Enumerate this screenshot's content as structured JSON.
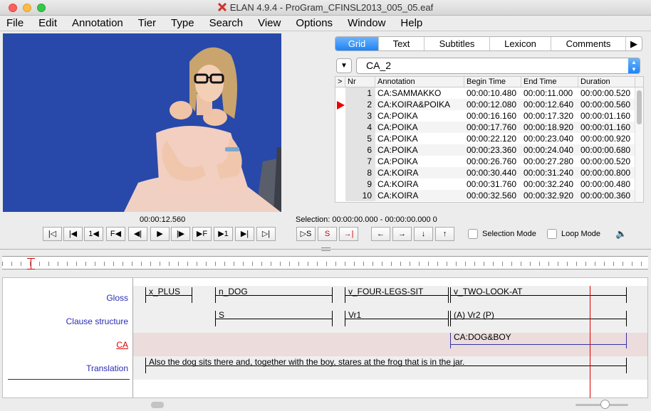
{
  "window": {
    "title": "ELAN 4.9.4 - ProGram_CFINSL2013_005_05.eaf"
  },
  "menu": [
    "File",
    "Edit",
    "Annotation",
    "Tier",
    "Type",
    "Search",
    "View",
    "Options",
    "Window",
    "Help"
  ],
  "tabs": [
    {
      "label": "Grid",
      "active": true
    },
    {
      "label": "Text"
    },
    {
      "label": "Subtitles"
    },
    {
      "label": "Lexicon"
    },
    {
      "label": "Comments"
    }
  ],
  "tier_selector": {
    "value": "CA_2"
  },
  "grid": {
    "headers": [
      ">",
      "Nr",
      "Annotation",
      "Begin Time",
      "End Time",
      "Duration"
    ],
    "rows": [
      {
        "nr": "1",
        "annotation": "CA:SAMMAKKO",
        "begin": "00:00:10.480",
        "end": "00:00:11.000",
        "duration": "00:00:00.520"
      },
      {
        "nr": "2",
        "annotation": "CA:KOIRA&POIKA",
        "begin": "00:00:12.080",
        "end": "00:00:12.640",
        "duration": "00:00:00.560",
        "current": true
      },
      {
        "nr": "3",
        "annotation": "CA:POIKA",
        "begin": "00:00:16.160",
        "end": "00:00:17.320",
        "duration": "00:00:01.160"
      },
      {
        "nr": "4",
        "annotation": "CA:POIKA",
        "begin": "00:00:17.760",
        "end": "00:00:18.920",
        "duration": "00:00:01.160"
      },
      {
        "nr": "5",
        "annotation": "CA:POIKA",
        "begin": "00:00:22.120",
        "end": "00:00:23.040",
        "duration": "00:00:00.920"
      },
      {
        "nr": "6",
        "annotation": "CA:POIKA",
        "begin": "00:00:23.360",
        "end": "00:00:24.040",
        "duration": "00:00:00.680"
      },
      {
        "nr": "7",
        "annotation": "CA:POIKA",
        "begin": "00:00:26.760",
        "end": "00:00:27.280",
        "duration": "00:00:00.520"
      },
      {
        "nr": "8",
        "annotation": "CA:KOIRA",
        "begin": "00:00:30.440",
        "end": "00:00:31.240",
        "duration": "00:00:00.800"
      },
      {
        "nr": "9",
        "annotation": "CA:KOIRA",
        "begin": "00:00:31.760",
        "end": "00:00:32.240",
        "duration": "00:00:00.480"
      },
      {
        "nr": "10",
        "annotation": "CA:KOIRA",
        "begin": "00:00:32.560",
        "end": "00:00:32.920",
        "duration": "00:00:00.360"
      }
    ]
  },
  "player": {
    "current_time": "00:00:12.560",
    "selection": "Selection: 00:00:00.000 - 00:00:00.000  0",
    "buttons": [
      "|◁",
      "|◀",
      "1◀",
      "F◀",
      "◀|",
      "▶",
      "|▶",
      "▶F",
      "▶1",
      "▶|",
      "▷|"
    ],
    "sel_buttons": [
      "▷S",
      "S",
      "→|"
    ],
    "nav_buttons": [
      "←",
      "→",
      "↓",
      "↑"
    ],
    "selection_mode": "Selection Mode",
    "loop_mode": "Loop Mode"
  },
  "tiers": {
    "names": [
      "Gloss",
      "Clause structure",
      "CA",
      "Translation"
    ],
    "gloss": [
      "x_PLUS",
      "n_DOG",
      "v_FOUR-LEGS-SIT",
      "v_TWO-LOOK-AT"
    ],
    "clause": [
      "S",
      "Vr1",
      "(A) Vr2 (P)"
    ],
    "ca": [
      "CA:DOG&BOY"
    ],
    "translation": [
      "Also the dog sits there and, together with the boy, stares at the frog that is in the jar."
    ]
  },
  "colors": {
    "accent": "#1f83f5",
    "cursor": "#dd0000",
    "tier_label": "#2a2ab8",
    "video_bg": "#2c4fb8"
  }
}
